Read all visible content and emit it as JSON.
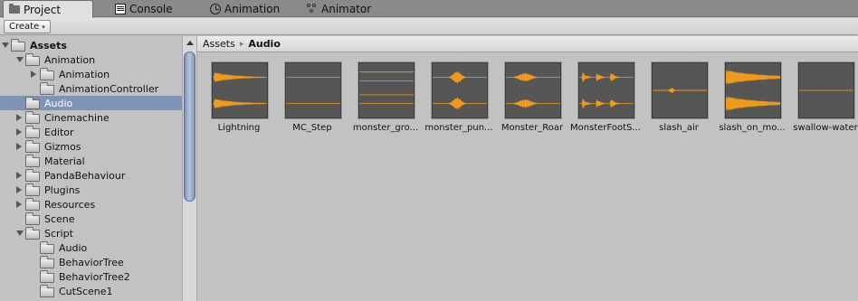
{
  "tabs": [
    {
      "label": "Project",
      "icon": "folder-icon",
      "active": true
    },
    {
      "label": "Console",
      "icon": "console-icon",
      "active": false
    },
    {
      "label": "Animation",
      "icon": "clock-icon",
      "active": false
    },
    {
      "label": "Animator",
      "icon": "animator-icon",
      "active": false
    }
  ],
  "toolbar": {
    "create_label": "Create",
    "create_caret": "▾"
  },
  "tree": [
    {
      "label": "Assets",
      "depth": 0,
      "arrow": "down",
      "bold": true,
      "selected": false
    },
    {
      "label": "Animation",
      "depth": 1,
      "arrow": "down",
      "bold": false,
      "selected": false
    },
    {
      "label": "Animation",
      "depth": 2,
      "arrow": "right",
      "bold": false,
      "selected": false
    },
    {
      "label": "AnimationController",
      "depth": 2,
      "arrow": "none",
      "bold": false,
      "selected": false
    },
    {
      "label": "Audio",
      "depth": 1,
      "arrow": "none",
      "bold": false,
      "selected": true
    },
    {
      "label": "Cinemachine",
      "depth": 1,
      "arrow": "right",
      "bold": false,
      "selected": false
    },
    {
      "label": "Editor",
      "depth": 1,
      "arrow": "right",
      "bold": false,
      "selected": false
    },
    {
      "label": "Gizmos",
      "depth": 1,
      "arrow": "right",
      "bold": false,
      "selected": false
    },
    {
      "label": "Material",
      "depth": 1,
      "arrow": "none",
      "bold": false,
      "selected": false
    },
    {
      "label": "PandaBehaviour",
      "depth": 1,
      "arrow": "right",
      "bold": false,
      "selected": false
    },
    {
      "label": "Plugins",
      "depth": 1,
      "arrow": "right",
      "bold": false,
      "selected": false
    },
    {
      "label": "Resources",
      "depth": 1,
      "arrow": "right",
      "bold": false,
      "selected": false
    },
    {
      "label": "Scene",
      "depth": 1,
      "arrow": "none",
      "bold": false,
      "selected": false
    },
    {
      "label": "Script",
      "depth": 1,
      "arrow": "down",
      "bold": false,
      "selected": false
    },
    {
      "label": "Audio",
      "depth": 2,
      "arrow": "none",
      "bold": false,
      "selected": false
    },
    {
      "label": "BehaviorTree",
      "depth": 2,
      "arrow": "none",
      "bold": false,
      "selected": false
    },
    {
      "label": "BehaviorTree2",
      "depth": 2,
      "arrow": "none",
      "bold": false,
      "selected": false
    },
    {
      "label": "CutScene1",
      "depth": 2,
      "arrow": "none",
      "bold": false,
      "selected": false
    }
  ],
  "breadcrumb": {
    "root": "Assets",
    "separator": "▸",
    "current": "Audio"
  },
  "colors": {
    "waveform": "#f09a1c",
    "thumb_bg": "#565656",
    "selection": "#7f94b4"
  },
  "assets": [
    {
      "label": "Lightning",
      "wave": "lightning"
    },
    {
      "label": "MC_Step",
      "wave": "flat"
    },
    {
      "label": "monster_gro...",
      "wave": "flat_lines"
    },
    {
      "label": "monster_pun...",
      "wave": "punch"
    },
    {
      "label": "Monster_Roar",
      "wave": "roar"
    },
    {
      "label": "MonsterFootS...",
      "wave": "footsteps"
    },
    {
      "label": "slash_air",
      "wave": "slash"
    },
    {
      "label": "slash_on_mo...",
      "wave": "loud"
    },
    {
      "label": "swallow-water",
      "wave": "flat_mono"
    }
  ]
}
